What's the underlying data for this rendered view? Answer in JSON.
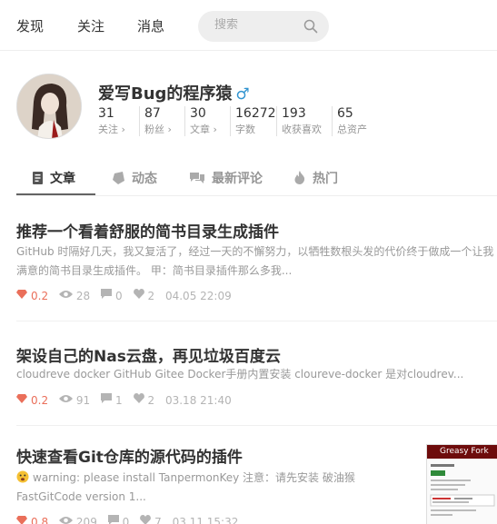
{
  "nav": {
    "discover": "发现",
    "follow": "关注",
    "message": "消息",
    "search_placeholder": "搜索"
  },
  "profile": {
    "username": "爱写Bug的程序猿",
    "gender_symbol": "♂",
    "stats": [
      {
        "num": "31",
        "label": "关注 ›"
      },
      {
        "num": "87",
        "label": "粉丝 ›"
      },
      {
        "num": "30",
        "label": "文章 ›"
      },
      {
        "num": "16272",
        "label": "字数"
      },
      {
        "num": "193",
        "label": "收获喜欢"
      },
      {
        "num": "65",
        "label": "总资产"
      }
    ]
  },
  "tabs": [
    {
      "label": "文章",
      "icon": "article-icon"
    },
    {
      "label": "动态",
      "icon": "dynamic-icon"
    },
    {
      "label": "最新评论",
      "icon": "comment-icon"
    },
    {
      "label": "热门",
      "icon": "fire-icon"
    }
  ],
  "articles": [
    {
      "title": "推荐一个看着舒服的简书目录生成插件",
      "abstract": "GitHub 时隔好几天，我又复活了，经过一天的不懈努力，以牺牲数根头发的代价终于做成一个让我满意的简书目录生成插件。 甲：简书目录插件那么多我...",
      "diamond": "0.2",
      "views": "28",
      "comments": "0",
      "likes": "2",
      "time": "04.05 22:09"
    },
    {
      "title": "架设自己的Nas云盘，再见垃圾百度云",
      "abstract": "cloudreve docker GitHub Gitee Docker手册内置安装 cloureve-docker 是对cloudrev...",
      "diamond": "0.2",
      "views": "91",
      "comments": "1",
      "likes": "2",
      "time": "03.18 21:40"
    },
    {
      "title": "快速查看Git仓库的源代码的插件",
      "abstract": "warning: please install TanpermonKey 注意：请先安装 破油猴 FastGitCode version 1...",
      "diamond": "0.8",
      "views": "209",
      "comments": "0",
      "likes": "7",
      "time": "03.11 15:32",
      "thumb_title": "Greasy Fork"
    }
  ],
  "colors": {
    "accent_red": "#ea6f5a",
    "gender_blue": "#3194d0"
  }
}
